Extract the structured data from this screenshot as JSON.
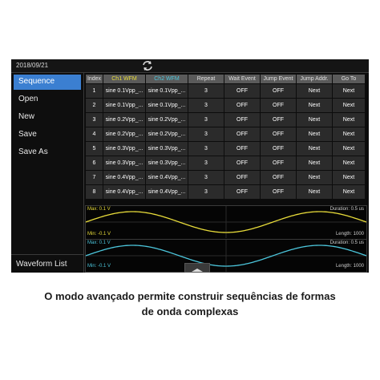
{
  "header": {
    "date": "2018/09/21",
    "sync_icon": "sync-icon"
  },
  "sidebar": {
    "items": [
      {
        "label": "Sequence",
        "active": true
      },
      {
        "label": "Open"
      },
      {
        "label": "New"
      },
      {
        "label": "Save"
      },
      {
        "label": "Save As"
      }
    ],
    "bottom": "Waveform List"
  },
  "table": {
    "headers": [
      "Index",
      "Ch1 WFM",
      "Ch2 WFM",
      "Repeat",
      "Wait Event",
      "Jump Event",
      "Jump Addr.",
      "Go To"
    ],
    "rows": [
      [
        "1",
        "sine 0.1Vpp_...",
        "sine 0.1Vpp_...",
        "3",
        "OFF",
        "OFF",
        "Next",
        "Next"
      ],
      [
        "2",
        "sine 0.1Vpp_...",
        "sine 0.1Vpp_...",
        "3",
        "OFF",
        "OFF",
        "Next",
        "Next"
      ],
      [
        "3",
        "sine 0.2Vpp_...",
        "sine 0.2Vpp_...",
        "3",
        "OFF",
        "OFF",
        "Next",
        "Next"
      ],
      [
        "4",
        "sine 0.2Vpp_...",
        "sine 0.2Vpp_...",
        "3",
        "OFF",
        "OFF",
        "Next",
        "Next"
      ],
      [
        "5",
        "sine 0.3Vpp_...",
        "sine 0.3Vpp_...",
        "3",
        "OFF",
        "OFF",
        "Next",
        "Next"
      ],
      [
        "6",
        "sine 0.3Vpp_...",
        "sine 0.3Vpp_...",
        "3",
        "OFF",
        "OFF",
        "Next",
        "Next"
      ],
      [
        "7",
        "sine 0.4Vpp_...",
        "sine 0.4Vpp_...",
        "3",
        "OFF",
        "OFF",
        "Next",
        "Next"
      ],
      [
        "8",
        "sine 0.4Vpp_...",
        "sine 0.4Vpp_...",
        "3",
        "OFF",
        "OFF",
        "Next",
        "Next"
      ]
    ]
  },
  "preview": {
    "ch1": {
      "max": "Max: 0.1 V",
      "min": "Min: -0.1 V",
      "duration": "Duration: 0.5 us",
      "length": "Length: 1000",
      "color": "#e8dc3a"
    },
    "ch2": {
      "max": "Max: 0.1 V",
      "min": "Min: -0.1 V",
      "duration": "Duration: 0.5 us",
      "length": "Length: 1000",
      "color": "#4cc6dc"
    }
  },
  "caption": {
    "line1": "O modo avançado permite construir sequências de formas",
    "line2": "de onda complexas"
  },
  "colors": {
    "accent": "#3b7fd1",
    "ch1": "#e8dc3a",
    "ch2": "#4cc6dc"
  }
}
